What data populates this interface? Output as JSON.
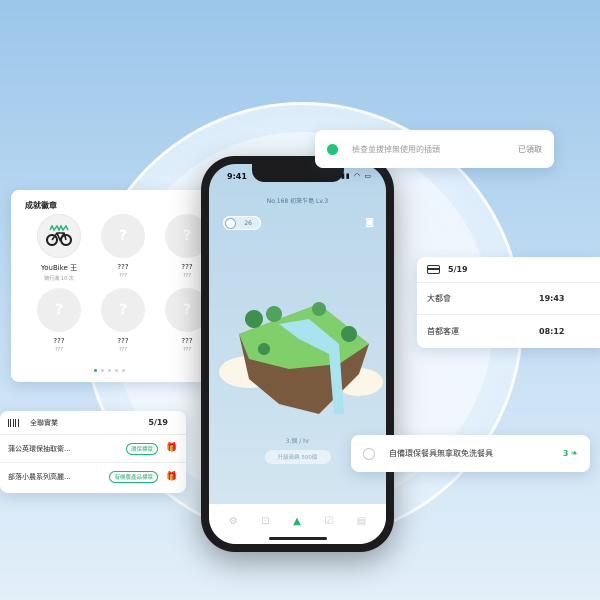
{
  "colors": {
    "accent": "#22b573",
    "background": "#bfdbf3"
  },
  "phone": {
    "time": "9:41",
    "island_title": "No.168 初來乍島 Lv.3",
    "badge_count": "26",
    "speed_text": "3.個 / hr",
    "upgrade_label": "升級島嶼 500個",
    "tabs": [
      {
        "icon": "gear-icon",
        "glyph": "⚙"
      },
      {
        "icon": "scan-icon",
        "glyph": "⊡"
      },
      {
        "icon": "mountain-icon",
        "glyph": "▲"
      },
      {
        "icon": "checklist-icon",
        "glyph": "☑"
      },
      {
        "icon": "book-icon",
        "glyph": "▤"
      }
    ]
  },
  "achievements": {
    "title": "成就徽章",
    "items": [
      {
        "name": "YouBike 王",
        "sub": "騎行滿 10 次",
        "earned": true
      },
      {
        "name": "???",
        "sub": "???",
        "earned": false
      },
      {
        "name": "???",
        "sub": "???",
        "earned": false
      },
      {
        "name": "???",
        "sub": "???",
        "earned": false
      },
      {
        "name": "???",
        "sub": "???",
        "earned": false
      },
      {
        "name": "???",
        "sub": "???",
        "earned": false
      }
    ]
  },
  "task_top": {
    "text": "檢查並拔掉無使用的插頭",
    "status": "已領取"
  },
  "bus": {
    "date": "5/19",
    "rows": [
      {
        "name": "大都會",
        "time": "19:43"
      },
      {
        "name": "首都客運",
        "time": "08:12"
      }
    ]
  },
  "purchases": {
    "title": "全聯實業",
    "count": "5/19",
    "rows": [
      {
        "name": "蒲公英環保抽取衛...",
        "tag": "環保標章"
      },
      {
        "name": "部落小農系列高麗...",
        "tag": "有機農產品標章"
      }
    ]
  },
  "task_bottom": {
    "text": "自備環保餐具無拿取免洗餐具",
    "reward": "3"
  }
}
